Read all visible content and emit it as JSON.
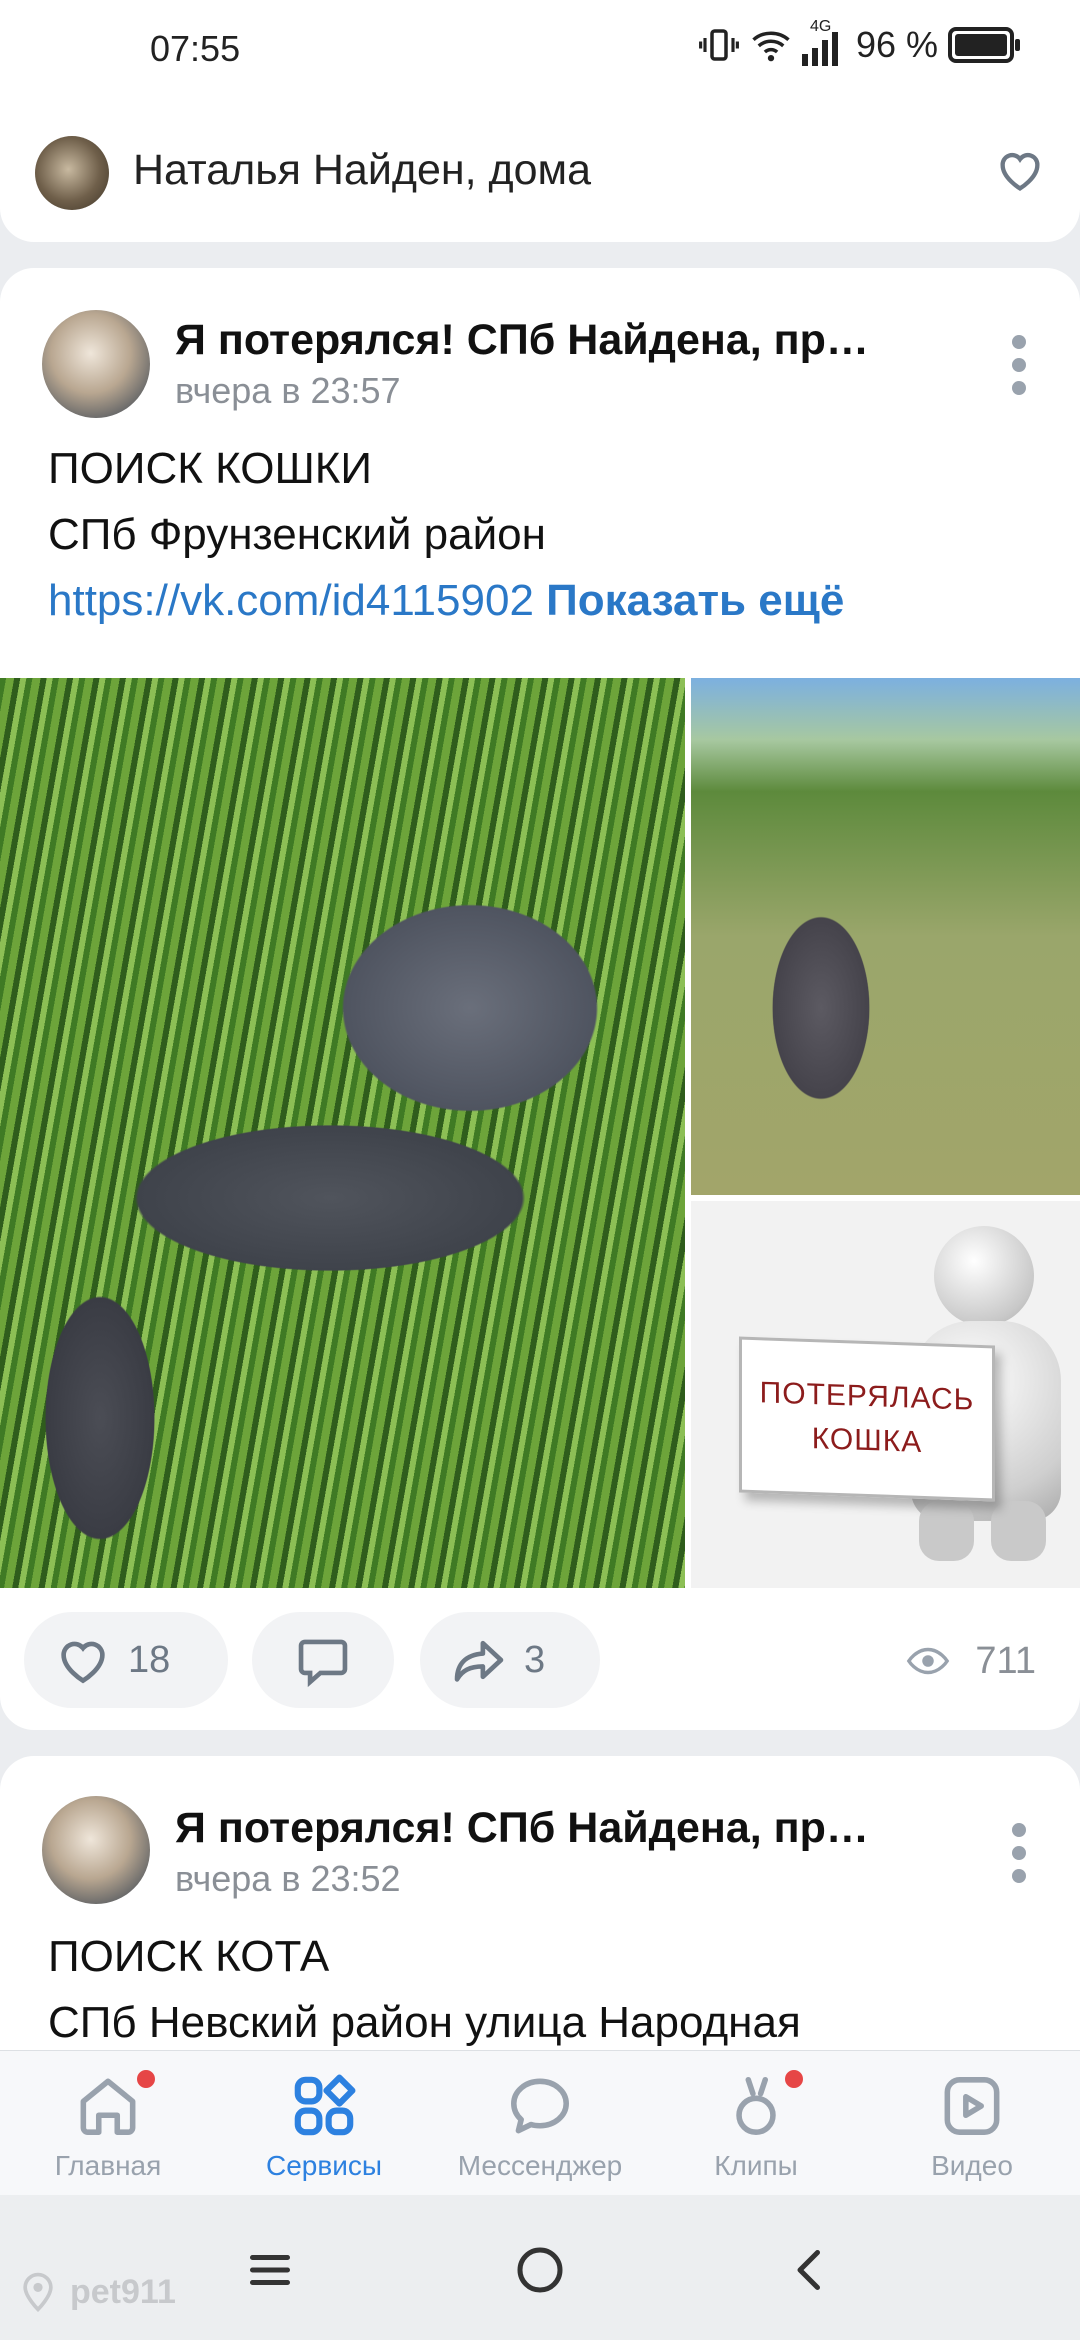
{
  "status_bar": {
    "time": "07:55",
    "network": "4G",
    "battery": "96 %"
  },
  "subscription": {
    "name": "Наталья Найден, дома",
    "icon": "heart-outline-icon"
  },
  "posts": [
    {
      "title": "Я потерялся! СПб Найдена, пр…",
      "time": "вчера в 23:57",
      "line1": "ПОИСК КОШКИ",
      "line2": "СПб Фрунзенский район",
      "link": "https://vk.com/id4115902",
      "show_more": "Показать ещё",
      "sign_line1": "ПОТЕРЯЛАСЬ",
      "sign_line2": "КОШКА",
      "likes": "18",
      "reposts": "3",
      "views": "711"
    },
    {
      "title": "Я потерялся! СПб Найдена, пр…",
      "time": "вчера в 23:52",
      "line1": "ПОИСК КОТА",
      "line2": "СПб Невский район улица Народная"
    }
  ],
  "tabbar": {
    "items": [
      {
        "label": "Главная",
        "icon": "home-icon",
        "badge": true
      },
      {
        "label": "Сервисы",
        "icon": "services-icon",
        "active": true
      },
      {
        "label": "Мессенджер",
        "icon": "chat-icon"
      },
      {
        "label": "Клипы",
        "icon": "clips-icon",
        "badge": true
      },
      {
        "label": "Видео",
        "icon": "video-icon"
      }
    ]
  },
  "watermark": "pet911",
  "colors": {
    "accent": "#2d81e0",
    "link": "#2a78c7",
    "badge": "#e64646",
    "secondary": "#99a2ad"
  }
}
